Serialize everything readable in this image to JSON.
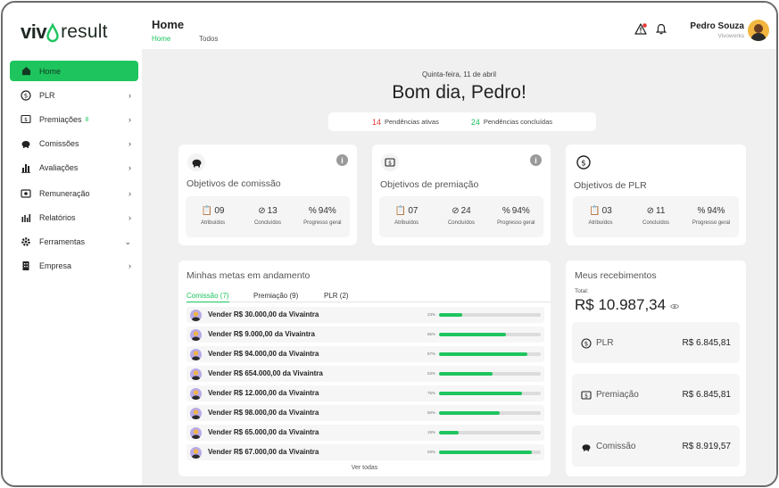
{
  "logo": {
    "part1": "viv",
    "part2": "result"
  },
  "sidebar": {
    "items": [
      {
        "label": "Home",
        "icon": "home-icon"
      },
      {
        "label": "PLR",
        "icon": "dollar-circle-icon"
      },
      {
        "label": "Premiações",
        "icon": "award-icon",
        "mini": "8"
      },
      {
        "label": "Comissões",
        "icon": "piggy-bank-icon"
      },
      {
        "label": "Avaliações",
        "icon": "bar-chart-icon"
      },
      {
        "label": "Remuneração",
        "icon": "wallet-icon"
      },
      {
        "label": "Relatórios",
        "icon": "report-icon"
      },
      {
        "label": "Ferramentas",
        "icon": "gear-icon"
      },
      {
        "label": "Empresa",
        "icon": "building-icon"
      }
    ]
  },
  "header": {
    "title": "Home",
    "tabs": [
      "Home",
      "Todos"
    ],
    "user_name": "Pedro Souza",
    "user_org": "Vivoworks"
  },
  "main": {
    "date": "Quinta-feira, 11 de abril",
    "greeting": "Bom dia, Pedro!",
    "pending_count": "14",
    "pending_label": "Pendências ativas",
    "done_count": "24",
    "done_label": "Pendências concluídas"
  },
  "cards": [
    {
      "title": "Objetivos de comissão",
      "atribuidos": "09",
      "concluidos": "13",
      "progresso": "94%"
    },
    {
      "title": "Objetivos de premiação",
      "atribuidos": "07",
      "concluidos": "24",
      "progresso": "94%"
    },
    {
      "title": "Objetivos de PLR",
      "atribuidos": "03",
      "concluidos": "11",
      "progresso": "94%"
    }
  ],
  "stat_labels": {
    "atribuidos": "Atribuídos",
    "concluidos": "Concluídos",
    "progresso": "Progresso geral"
  },
  "metas": {
    "title": "Minhas metas em andamento",
    "tabs": [
      "Comissão (7)",
      "Premiação (9)",
      "PLR (2)"
    ],
    "rows": [
      {
        "text": "Vender R$ 30.000,00 da Vivaintra",
        "pct_label": "23%",
        "pct": 23
      },
      {
        "text": "Vender R$ 9.000,00 da Vivaintra",
        "pct_label": "66%",
        "pct": 66
      },
      {
        "text": "Vender R$ 94.000,00 da Vivaintra",
        "pct_label": "87%",
        "pct": 87
      },
      {
        "text": "Vender R$ 654.000,00 da Vivaintra",
        "pct_label": "53%",
        "pct": 53
      },
      {
        "text": "Vender R$ 12.000,00 da Vivaintra",
        "pct_label": "75%",
        "pct": 82
      },
      {
        "text": "Vender R$ 98.000,00 da Vivaintra",
        "pct_label": "60%",
        "pct": 60
      },
      {
        "text": "Vender R$ 65.000,00 da Vivaintra",
        "pct_label": "19%",
        "pct": 19
      },
      {
        "text": "Vender R$ 67.000,00 da Vivaintra",
        "pct_label": "93%",
        "pct": 91
      }
    ],
    "ver_todas": "Ver todas"
  },
  "recebimentos": {
    "title": "Meus recebimentos",
    "total_label": "Total:",
    "total": "R$ 10.987,34",
    "items": [
      {
        "label": "PLR",
        "value": "R$ 6.845,81"
      },
      {
        "label": "Premiação",
        "value": "R$ 6.845,81"
      },
      {
        "label": "Comissão",
        "value": "R$ 8.919,57"
      }
    ]
  },
  "colors": {
    "accent": "#1ec55e",
    "alert": "#e53935",
    "background": "#f0f0f0"
  }
}
